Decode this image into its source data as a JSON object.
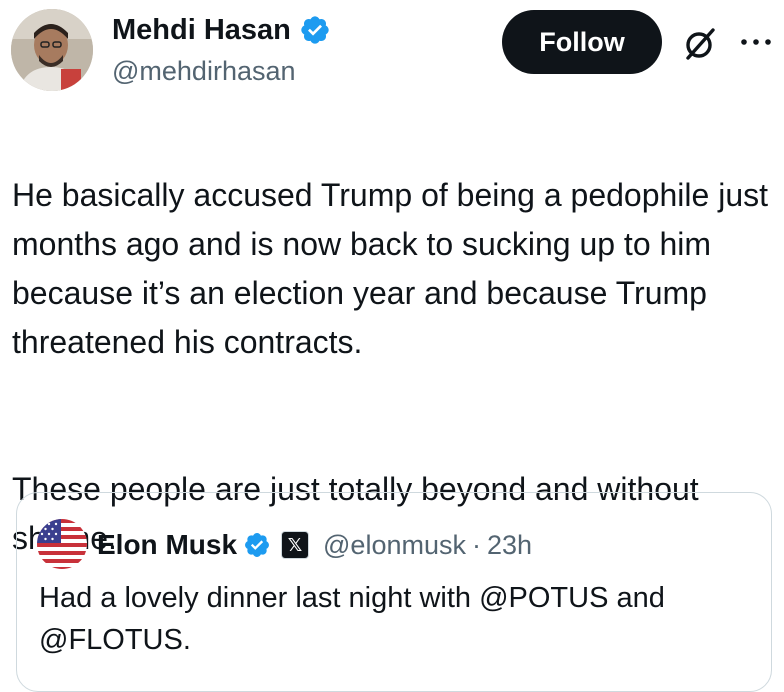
{
  "author": {
    "display_name": "Mehdi Hasan",
    "handle": "@mehdirhasan",
    "verified_icon": "verified-badge-icon",
    "avatar_icon": "avatar-photo"
  },
  "actions": {
    "follow_label": "Follow",
    "grok_icon": "grok-icon",
    "more_icon": "more-options-icon"
  },
  "tweet": {
    "paragraphs": [
      "He basically accused Trump of being a pedophile just months ago and is now back to sucking up to him because it’s an election year and because Trump threatened his contracts.",
      "These people are just totally beyond and without shame."
    ]
  },
  "quote": {
    "display_name": "Elon Musk",
    "handle": "@elonmusk",
    "separator": "·",
    "time": "23h",
    "badge_label": "𝕏",
    "text": "Had a lovely dinner last night with @POTUS and @FLOTUS."
  },
  "colors": {
    "text_primary": "#0f1419",
    "text_secondary": "#536471",
    "verified_blue": "#1d9bf0",
    "border": "#cfd9de",
    "button_bg": "#0f1419"
  }
}
